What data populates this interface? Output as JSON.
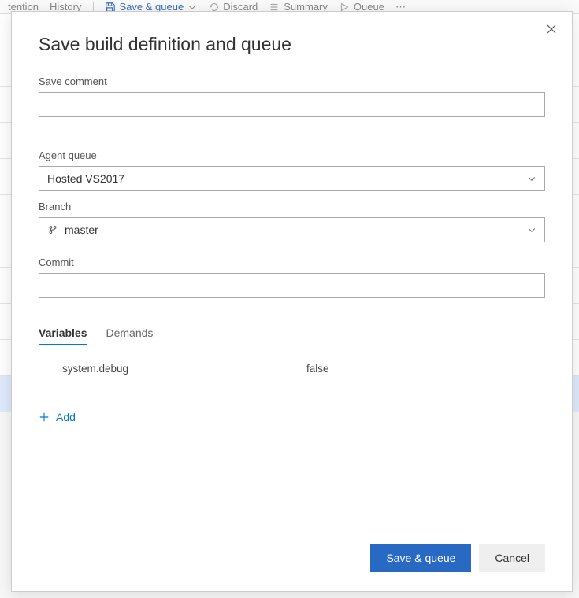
{
  "toolbar": {
    "tention": "tention",
    "history": "History",
    "save_queue": "Save & queue",
    "discard": "Discard",
    "summary": "Summary",
    "queue": "Queue",
    "more": "⋯"
  },
  "dialog": {
    "title": "Save build definition and queue",
    "save_comment_label": "Save comment",
    "save_comment_value": "",
    "agent_queue_label": "Agent queue",
    "agent_queue_value": "Hosted VS2017",
    "branch_label": "Branch",
    "branch_value": "master",
    "commit_label": "Commit",
    "commit_value": "",
    "tabs": [
      {
        "label": "Variables",
        "active": true
      },
      {
        "label": "Demands",
        "active": false
      }
    ],
    "variables": [
      {
        "name": "system.debug",
        "value": "false"
      }
    ],
    "add_label": "Add",
    "save_queue_button": "Save & queue",
    "cancel_button": "Cancel"
  }
}
